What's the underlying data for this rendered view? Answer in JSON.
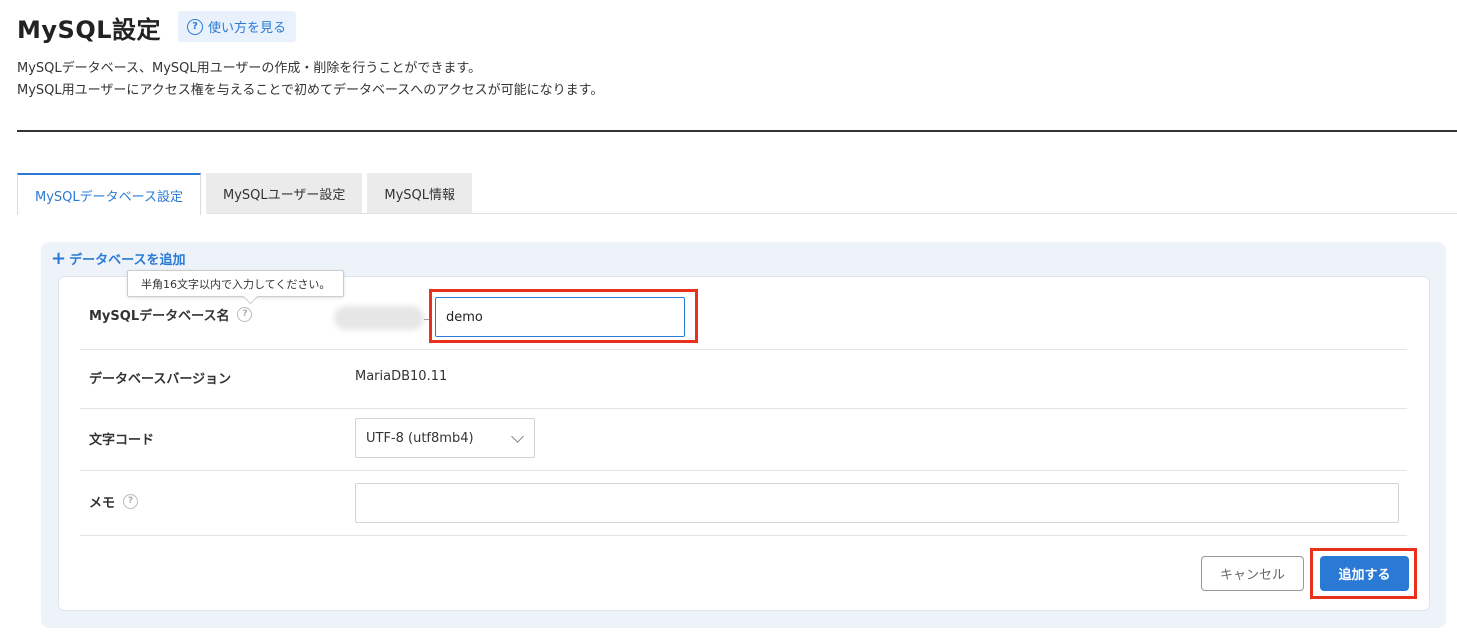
{
  "header": {
    "title": "MySQL設定",
    "help_link": "使い方を見る",
    "description_line1": "MySQLデータベース、MySQL用ユーザーの作成・削除を行うことができます。",
    "description_line2": "MySQL用ユーザーにアクセス権を与えることで初めてデータベースへのアクセスが可能になります。"
  },
  "tabs": [
    {
      "label": "MySQLデータベース設定",
      "active": true
    },
    {
      "label": "MySQLユーザー設定",
      "active": false
    },
    {
      "label": "MySQL情報",
      "active": false
    }
  ],
  "panel": {
    "add_db_label": "データベースを追加"
  },
  "form": {
    "tooltip": "半角16文字以内で入力してください。",
    "db_name_label": "MySQLデータベース名",
    "db_name_prefix_separator": "_",
    "db_name_value": "demo",
    "version_label": "データベースバージョン",
    "version_value": "MariaDB10.11",
    "charset_label": "文字コード",
    "charset_value": "UTF-8 (utf8mb4)",
    "memo_label": "メモ",
    "memo_value": ""
  },
  "buttons": {
    "cancel": "キャンセル",
    "add": "追加する"
  },
  "colors": {
    "accent": "#2a7ad5",
    "highlight": "#e8301c"
  }
}
